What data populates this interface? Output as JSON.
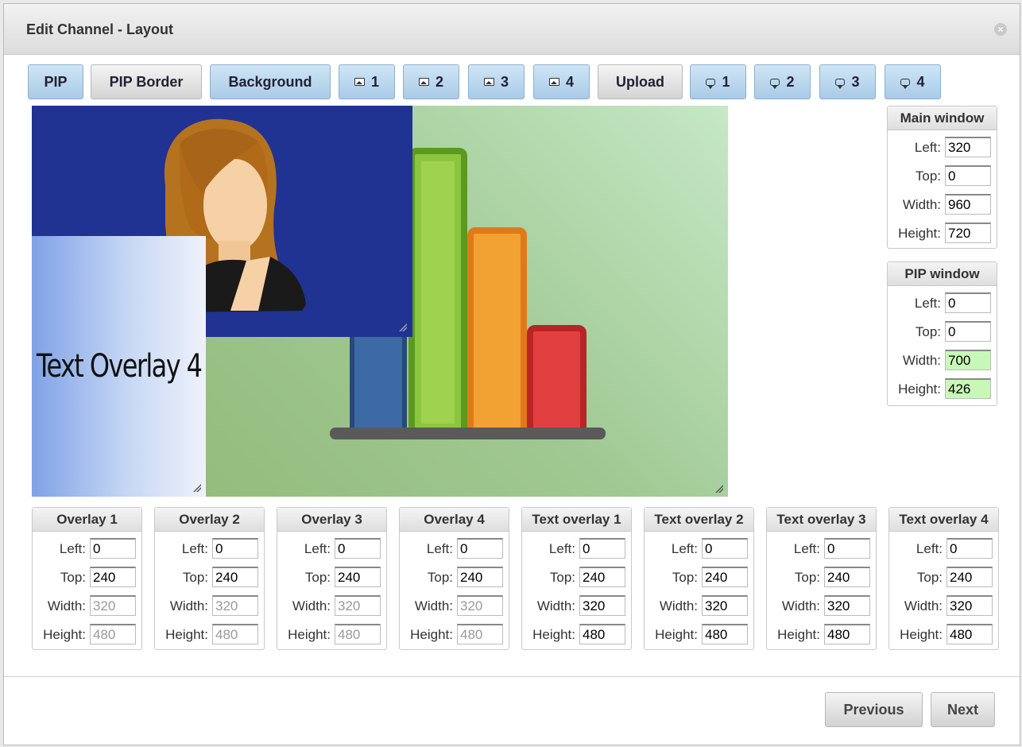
{
  "dialog": {
    "title": "Edit Channel - Layout",
    "close_icon": "close-icon"
  },
  "toolbar": {
    "pip": "PIP",
    "pip_border": "PIP Border",
    "background": "Background",
    "image1": "1",
    "image2": "2",
    "image3": "3",
    "image4": "4",
    "upload": "Upload",
    "text1": "1",
    "text2": "2",
    "text3": "3",
    "text4": "4"
  },
  "preview": {
    "text_overlay_content": "Text Overlay 4",
    "colors": {
      "pip_bg": "#203292",
      "main_bg": "#a0c993"
    }
  },
  "labels": {
    "left": "Left:",
    "top": "Top:",
    "width": "Width:",
    "height": "Height:"
  },
  "main_window": {
    "title": "Main window",
    "left": "320",
    "top": "0",
    "width": "960",
    "height": "720"
  },
  "pip_window": {
    "title": "PIP window",
    "left": "0",
    "top": "0",
    "width": "700",
    "height": "426"
  },
  "overlays": [
    {
      "title": "Overlay 1",
      "left": "0",
      "top": "240",
      "width": "320",
      "height": "480"
    },
    {
      "title": "Overlay 2",
      "left": "0",
      "top": "240",
      "width": "320",
      "height": "480"
    },
    {
      "title": "Overlay 3",
      "left": "0",
      "top": "240",
      "width": "320",
      "height": "480"
    },
    {
      "title": "Overlay 4",
      "left": "0",
      "top": "240",
      "width": "320",
      "height": "480"
    },
    {
      "title": "Text overlay 1",
      "left": "0",
      "top": "240",
      "width": "320",
      "height": "480"
    },
    {
      "title": "Text overlay 2",
      "left": "0",
      "top": "240",
      "width": "320",
      "height": "480"
    },
    {
      "title": "Text overlay 3",
      "left": "0",
      "top": "240",
      "width": "320",
      "height": "480"
    },
    {
      "title": "Text overlay 4",
      "left": "0",
      "top": "240",
      "width": "320",
      "height": "480"
    }
  ],
  "footer": {
    "previous": "Previous",
    "next": "Next"
  }
}
